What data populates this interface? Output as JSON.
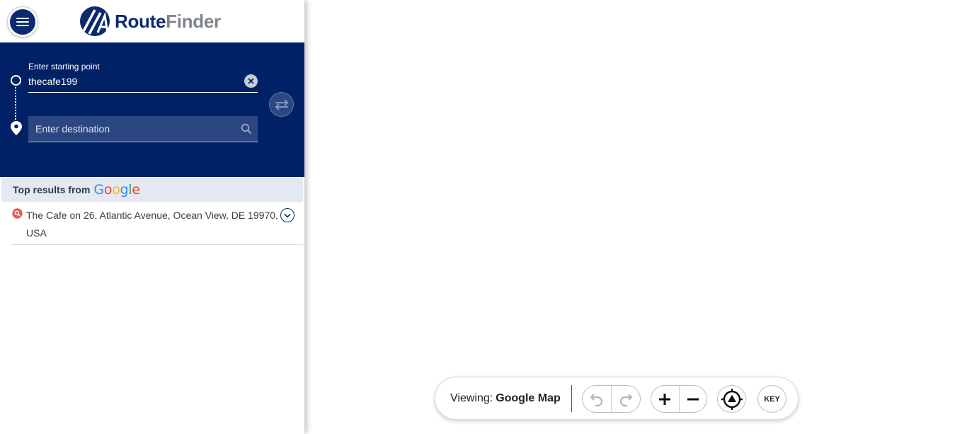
{
  "app": {
    "logo": {
      "part1": "Route",
      "part2": "Finder"
    },
    "menu_icon": "hamburger-icon"
  },
  "route": {
    "start_label": "Enter starting point",
    "start_value": "thecafe199",
    "destination_placeholder": "Enter destination"
  },
  "results": {
    "title": "Top results from",
    "provider": "Google",
    "items": [
      {
        "text": "The Cafe on 26, Atlantic Avenue, Ocean View, DE 19970, USA"
      }
    ]
  },
  "map_toolbar": {
    "viewing_label": "Viewing:",
    "viewing_value": "Google Map",
    "key_label": "KEY"
  },
  "colors": {
    "brand_navy": "#002166",
    "logo_gray": "#7f858c",
    "results_header_bg": "#e3e8f1",
    "result_pin": "#e85d5d"
  }
}
